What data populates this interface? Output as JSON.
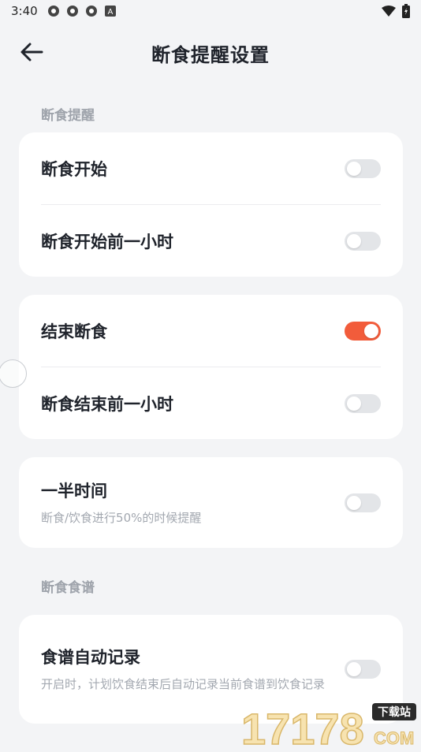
{
  "status": {
    "time": "3:40",
    "battery_text": "",
    "wifi": "wifi-icon"
  },
  "header": {
    "title": "断食提醒设置",
    "back_icon": "arrow-left-icon"
  },
  "sections": [
    {
      "label": "断食提醒"
    },
    {
      "label": "断食食谱"
    }
  ],
  "cards": {
    "start": {
      "rows": [
        {
          "label": "断食开始",
          "on": false
        },
        {
          "label": "断食开始前一小时",
          "on": false
        }
      ]
    },
    "end": {
      "rows": [
        {
          "label": "结束断食",
          "on": true
        },
        {
          "label": "断食结束前一小时",
          "on": false
        }
      ]
    },
    "half": {
      "label": "一半时间",
      "sub": "断食/饮食进行50%的时候提醒",
      "on": false
    },
    "recipe": {
      "label": "食谱自动记录",
      "sub": "开启时，计划饮食结束后自动记录当前食谱到饮食记录",
      "on": false
    }
  },
  "watermark": {
    "number": "17178",
    "badge": "下载站",
    "domain": "COM"
  },
  "colors": {
    "accent": "#f25c3b",
    "toggle_off": "#e3e5e8",
    "background": "#f3f4f6"
  }
}
